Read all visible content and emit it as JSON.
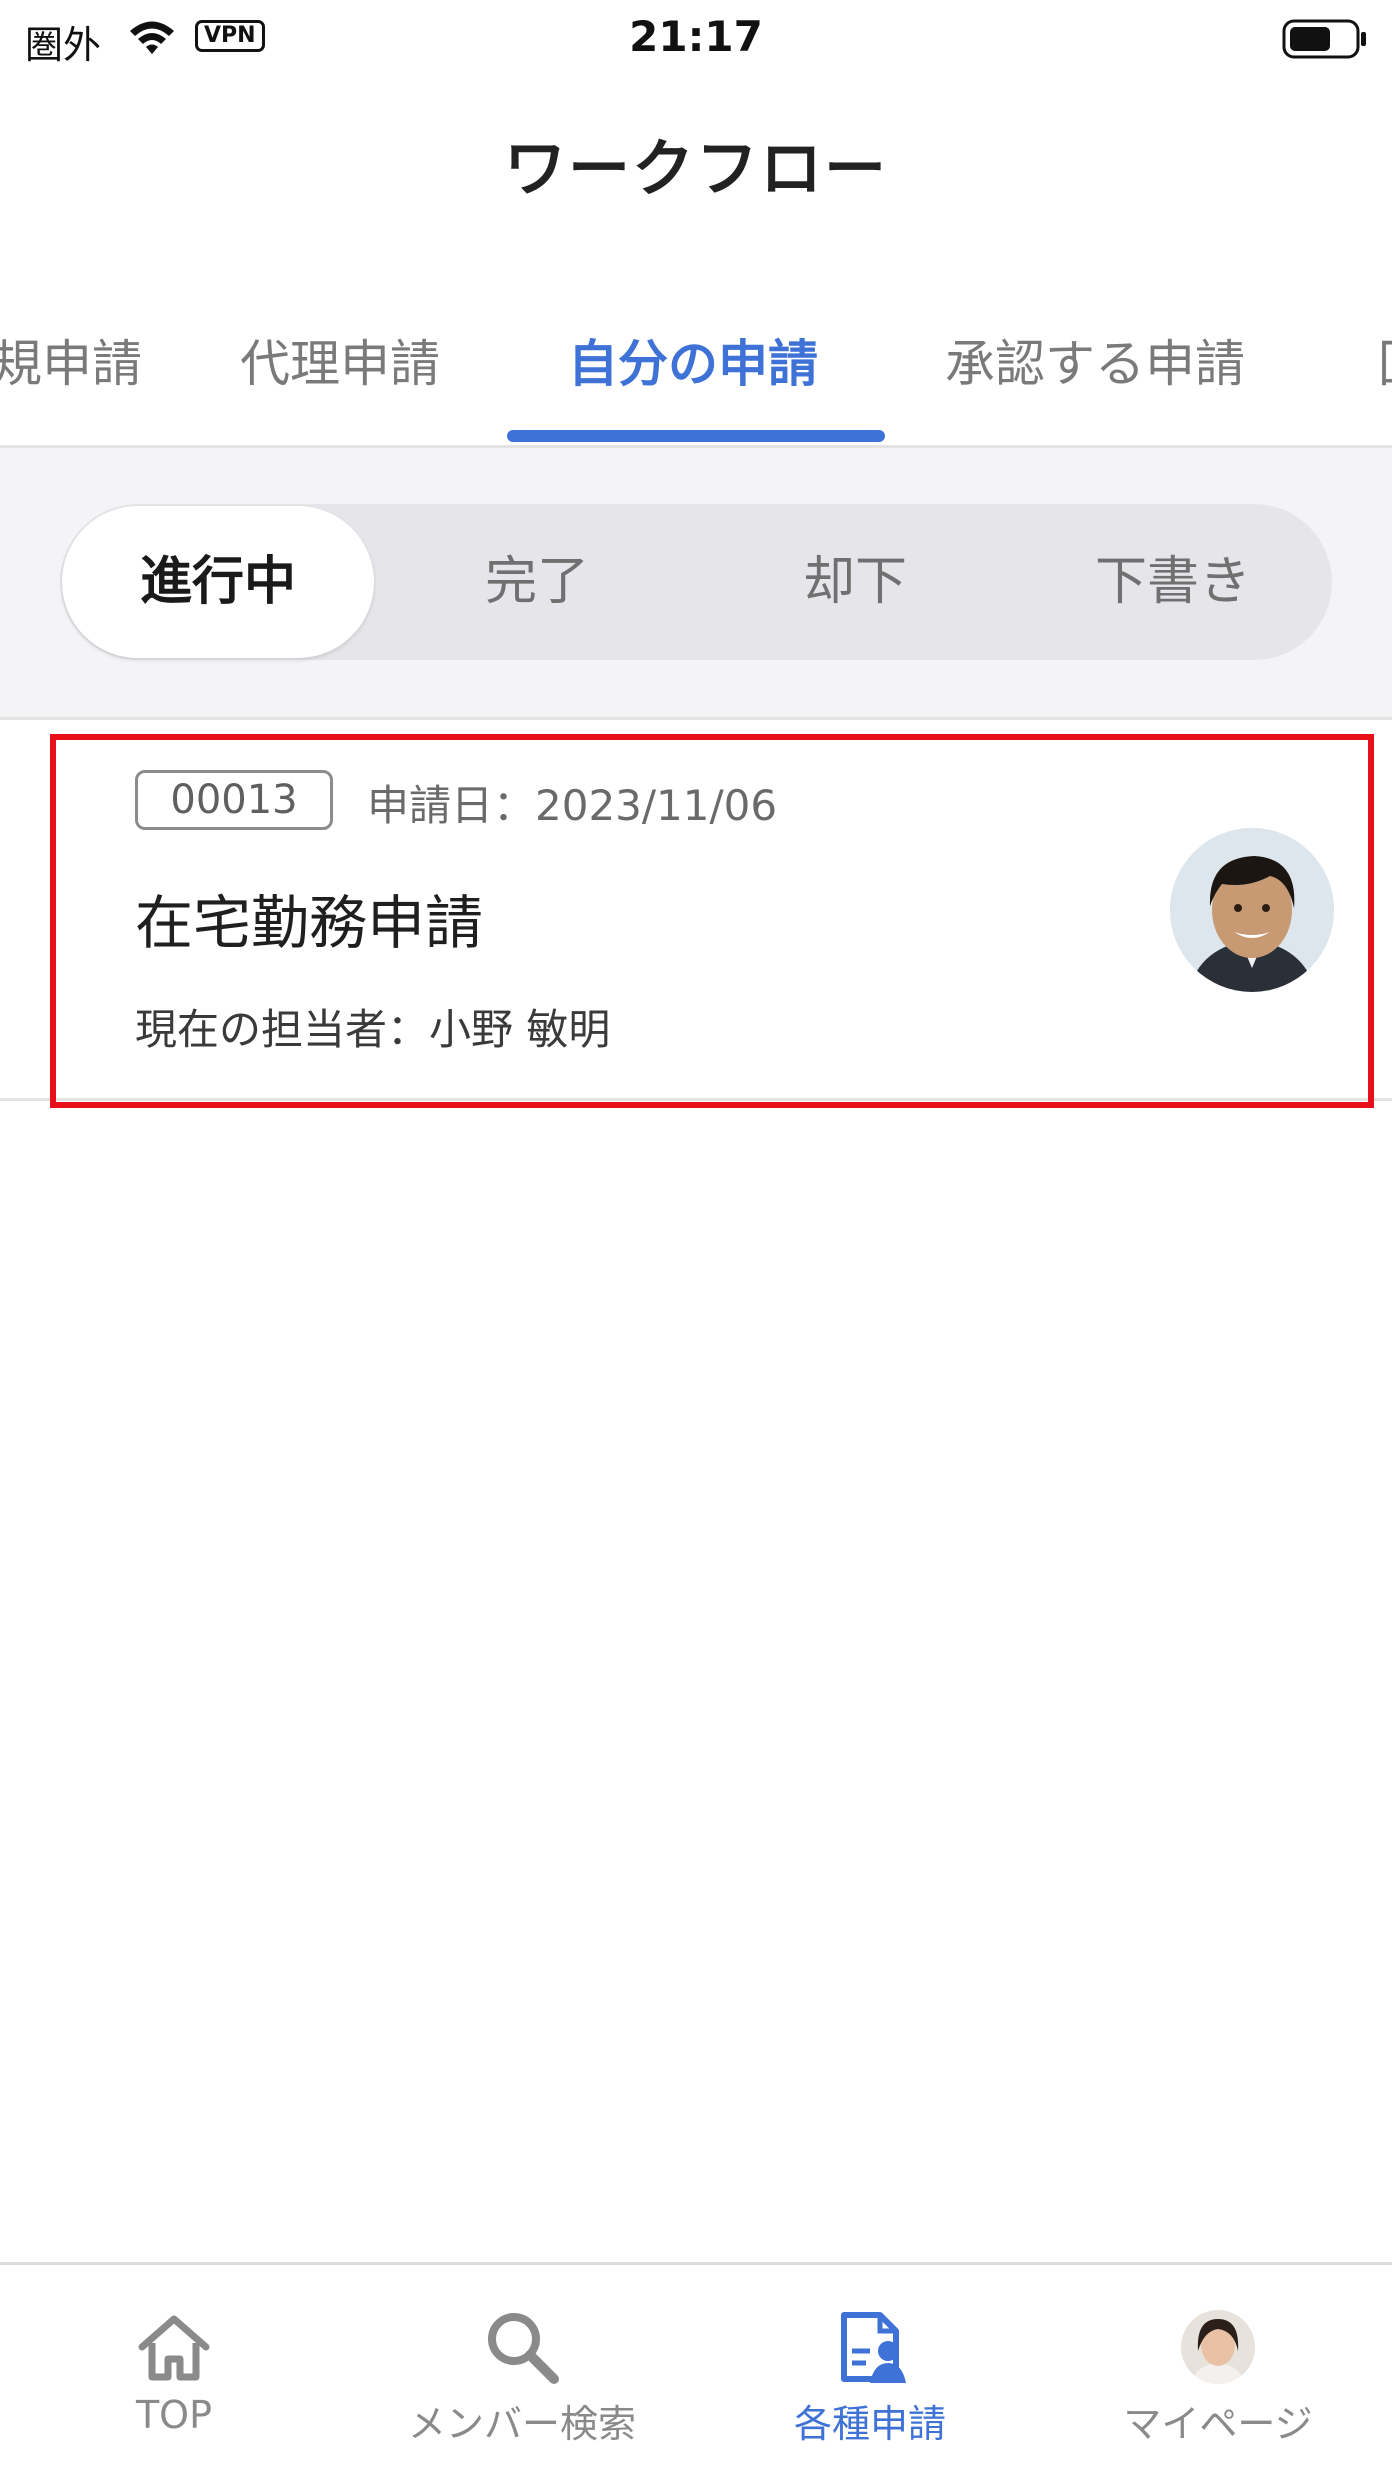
{
  "status_bar": {
    "carrier": "圏外",
    "vpn": "VPN",
    "time": "21:17"
  },
  "header": {
    "title": "ワークフロー"
  },
  "tabs": [
    {
      "label": "規申請",
      "active": false
    },
    {
      "label": "代理申請",
      "active": false
    },
    {
      "label": "自分の申請",
      "active": true
    },
    {
      "label": "承認する申請",
      "active": false
    },
    {
      "label": "回",
      "active": false
    }
  ],
  "filter": {
    "segments": [
      {
        "label": "進行中",
        "selected": true
      },
      {
        "label": "完了",
        "selected": false
      },
      {
        "label": "却下",
        "selected": false
      },
      {
        "label": "下書き",
        "selected": false
      }
    ]
  },
  "requests": [
    {
      "id": "00013",
      "date_line": "申請日：2023/11/06",
      "title": "在宅勤務申請",
      "assignee_line": "現在の担当者：小野 敏明"
    }
  ],
  "bottom_nav": {
    "items": [
      {
        "label": "TOP",
        "icon": "home-icon",
        "active": false
      },
      {
        "label": "メンバー検索",
        "icon": "search-icon",
        "active": false
      },
      {
        "label": "各種申請",
        "icon": "application-icon",
        "active": true
      },
      {
        "label": "マイページ",
        "icon": "user-avatar-icon",
        "active": false
      }
    ]
  },
  "colors": {
    "accent": "#3e72d6",
    "highlight": "#e8101a",
    "background_gray": "#f4f4f6"
  }
}
